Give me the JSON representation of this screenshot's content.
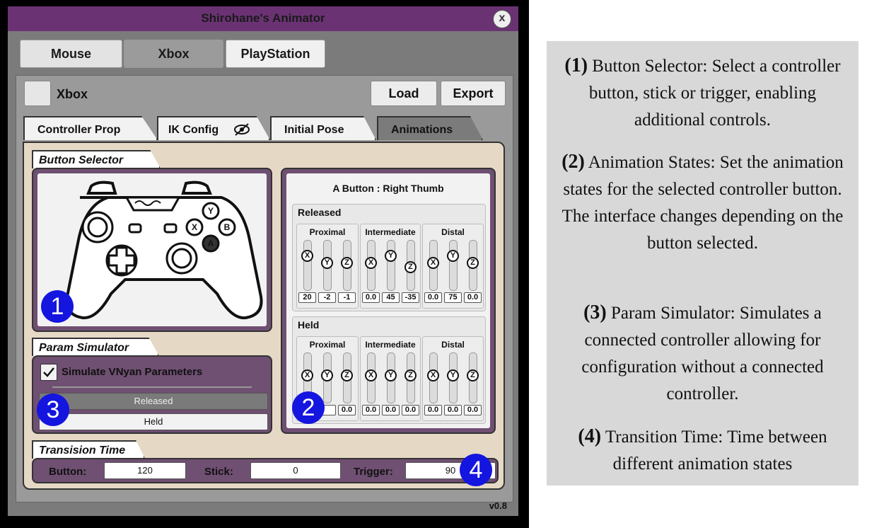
{
  "window": {
    "title": "Shirohane's Animator",
    "close": "x",
    "version": "v0.8"
  },
  "top_buttons": [
    "Mouse",
    "Xbox",
    "PlayStation"
  ],
  "profile": {
    "name": "Xbox",
    "load": "Load",
    "export": "Export"
  },
  "tabs": [
    "Controller Prop",
    "IK Config",
    "Initial Pose",
    "Animations"
  ],
  "button_selector": {
    "label": "Button Selector",
    "controller_labels": [
      "Y",
      "X",
      "B",
      "A"
    ]
  },
  "animation_states": {
    "title": "A Button : Right Thumb",
    "group_names": [
      "Proximal",
      "Intermediate",
      "Distal"
    ],
    "axis_glyphs": [
      "X",
      "Y",
      "Z"
    ],
    "released": {
      "label": "Released",
      "values": [
        "20",
        "-2",
        "-1",
        "0.0",
        "45",
        "-35",
        "0.0",
        "75",
        "0.0"
      ]
    },
    "held": {
      "label": "Held",
      "values": [
        "",
        "",
        "0.0",
        "0.0",
        "0.0",
        "0.0",
        "0.0",
        "0.0",
        "0.0"
      ]
    }
  },
  "param_simulator": {
    "label": "Param Simulator",
    "checkbox": "Simulate VNyan Parameters",
    "checked": true,
    "released": "Released",
    "held": "Held"
  },
  "transition_time": {
    "label": "Transision Time",
    "button_label": "Button:",
    "button_value": "120",
    "stick_label": "Stick:",
    "stick_value": "0",
    "trigger_label": "Trigger:",
    "trigger_value": "90"
  },
  "badges": [
    "1",
    "2",
    "3",
    "4"
  ],
  "help": {
    "items": [
      {
        "num": "(1)",
        "text": "Button Selector: Select a controller button, stick or trigger, enabling additional controls."
      },
      {
        "num": "(2)",
        "text": "Animation States:  Set the animation states for the selected controller button. The interface changes depending on the button selected."
      },
      {
        "num": "(3)",
        "text": "Param Simulator: Simulates a connected controller allowing for configuration without a connected controller."
      },
      {
        "num": "(4)",
        "text": "Transition Time: Time between different animation states"
      }
    ]
  },
  "colors": {
    "accent_purple": "#6a3273",
    "panel_purple": "#6f4f72",
    "badge_blue": "#1515e0",
    "content_bg": "#e5d9c6"
  }
}
